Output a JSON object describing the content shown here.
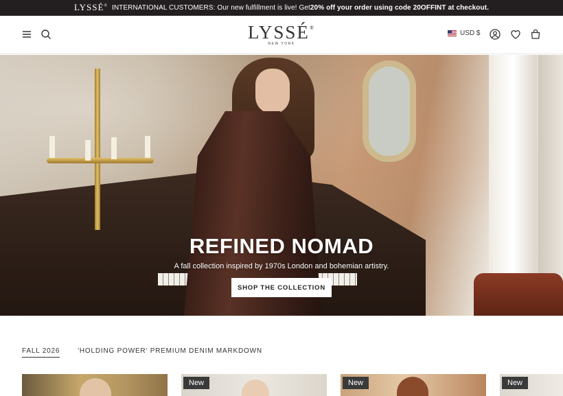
{
  "announcement": {
    "logo": "LYSSÉ",
    "logo_mark": "®",
    "logo_sub": "NEW YORK",
    "text_plain": "INTERNATIONAL CUSTOMERS: Our new fulfillment is live! Get ",
    "text_bold": "20% off your order using code 20OFFINT at checkout."
  },
  "header": {
    "logo": "LYSSÉ",
    "logo_mark": "®",
    "logo_sub": "NEW YORK",
    "currency": "USD $",
    "icons": [
      "menu-icon",
      "search-icon",
      "account-icon",
      "wishlist-icon",
      "cart-icon"
    ]
  },
  "hero": {
    "title": "REFINED NOMAD",
    "subtitle": "A fall collection inspired by 1970s London and bohemian artistry.",
    "cta": "SHOP THE COLLECTION"
  },
  "tabs": [
    {
      "label": "FALL 2026",
      "active": true
    },
    {
      "label": "'HOLDING POWER' PREMIUM DENIM MARKDOWN",
      "active": false
    }
  ],
  "products": [
    {
      "badge": ""
    },
    {
      "badge": "New"
    },
    {
      "badge": "New"
    },
    {
      "badge": "New"
    }
  ],
  "colors": {
    "announcement_bg": "#231f20",
    "text": "#222222",
    "badge_bg": "#3a3a3a"
  }
}
